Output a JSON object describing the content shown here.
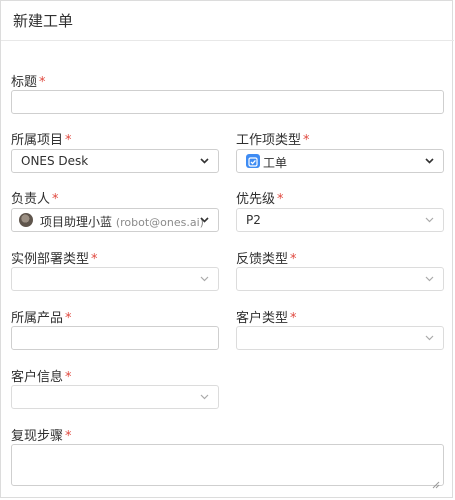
{
  "dialog": {
    "title": "新建工单"
  },
  "form": {
    "required_mark": "*",
    "title": {
      "label": "标题",
      "value": ""
    },
    "project": {
      "label": "所属项目",
      "value": "ONES Desk"
    },
    "issue_type": {
      "label": "工作项类型",
      "value": "工单",
      "icon": "ticket-check-icon",
      "icon_color": "#3f8cf3"
    },
    "assignee": {
      "label": "负责人",
      "name": "项目助理小蓝",
      "email": "(robot@ones.ai)"
    },
    "priority": {
      "label": "优先级",
      "value": "P2"
    },
    "deploy_type": {
      "label": "实例部署类型",
      "value": ""
    },
    "feedback_type": {
      "label": "反馈类型",
      "value": ""
    },
    "product": {
      "label": "所属产品",
      "value": ""
    },
    "customer_type": {
      "label": "客户类型",
      "value": ""
    },
    "customer_info": {
      "label": "客户信息",
      "value": ""
    },
    "repro_steps": {
      "label": "复现步骤",
      "value": ""
    }
  },
  "colors": {
    "required": "#e0483e",
    "border": "#cfcfcf",
    "text": "#303030"
  }
}
